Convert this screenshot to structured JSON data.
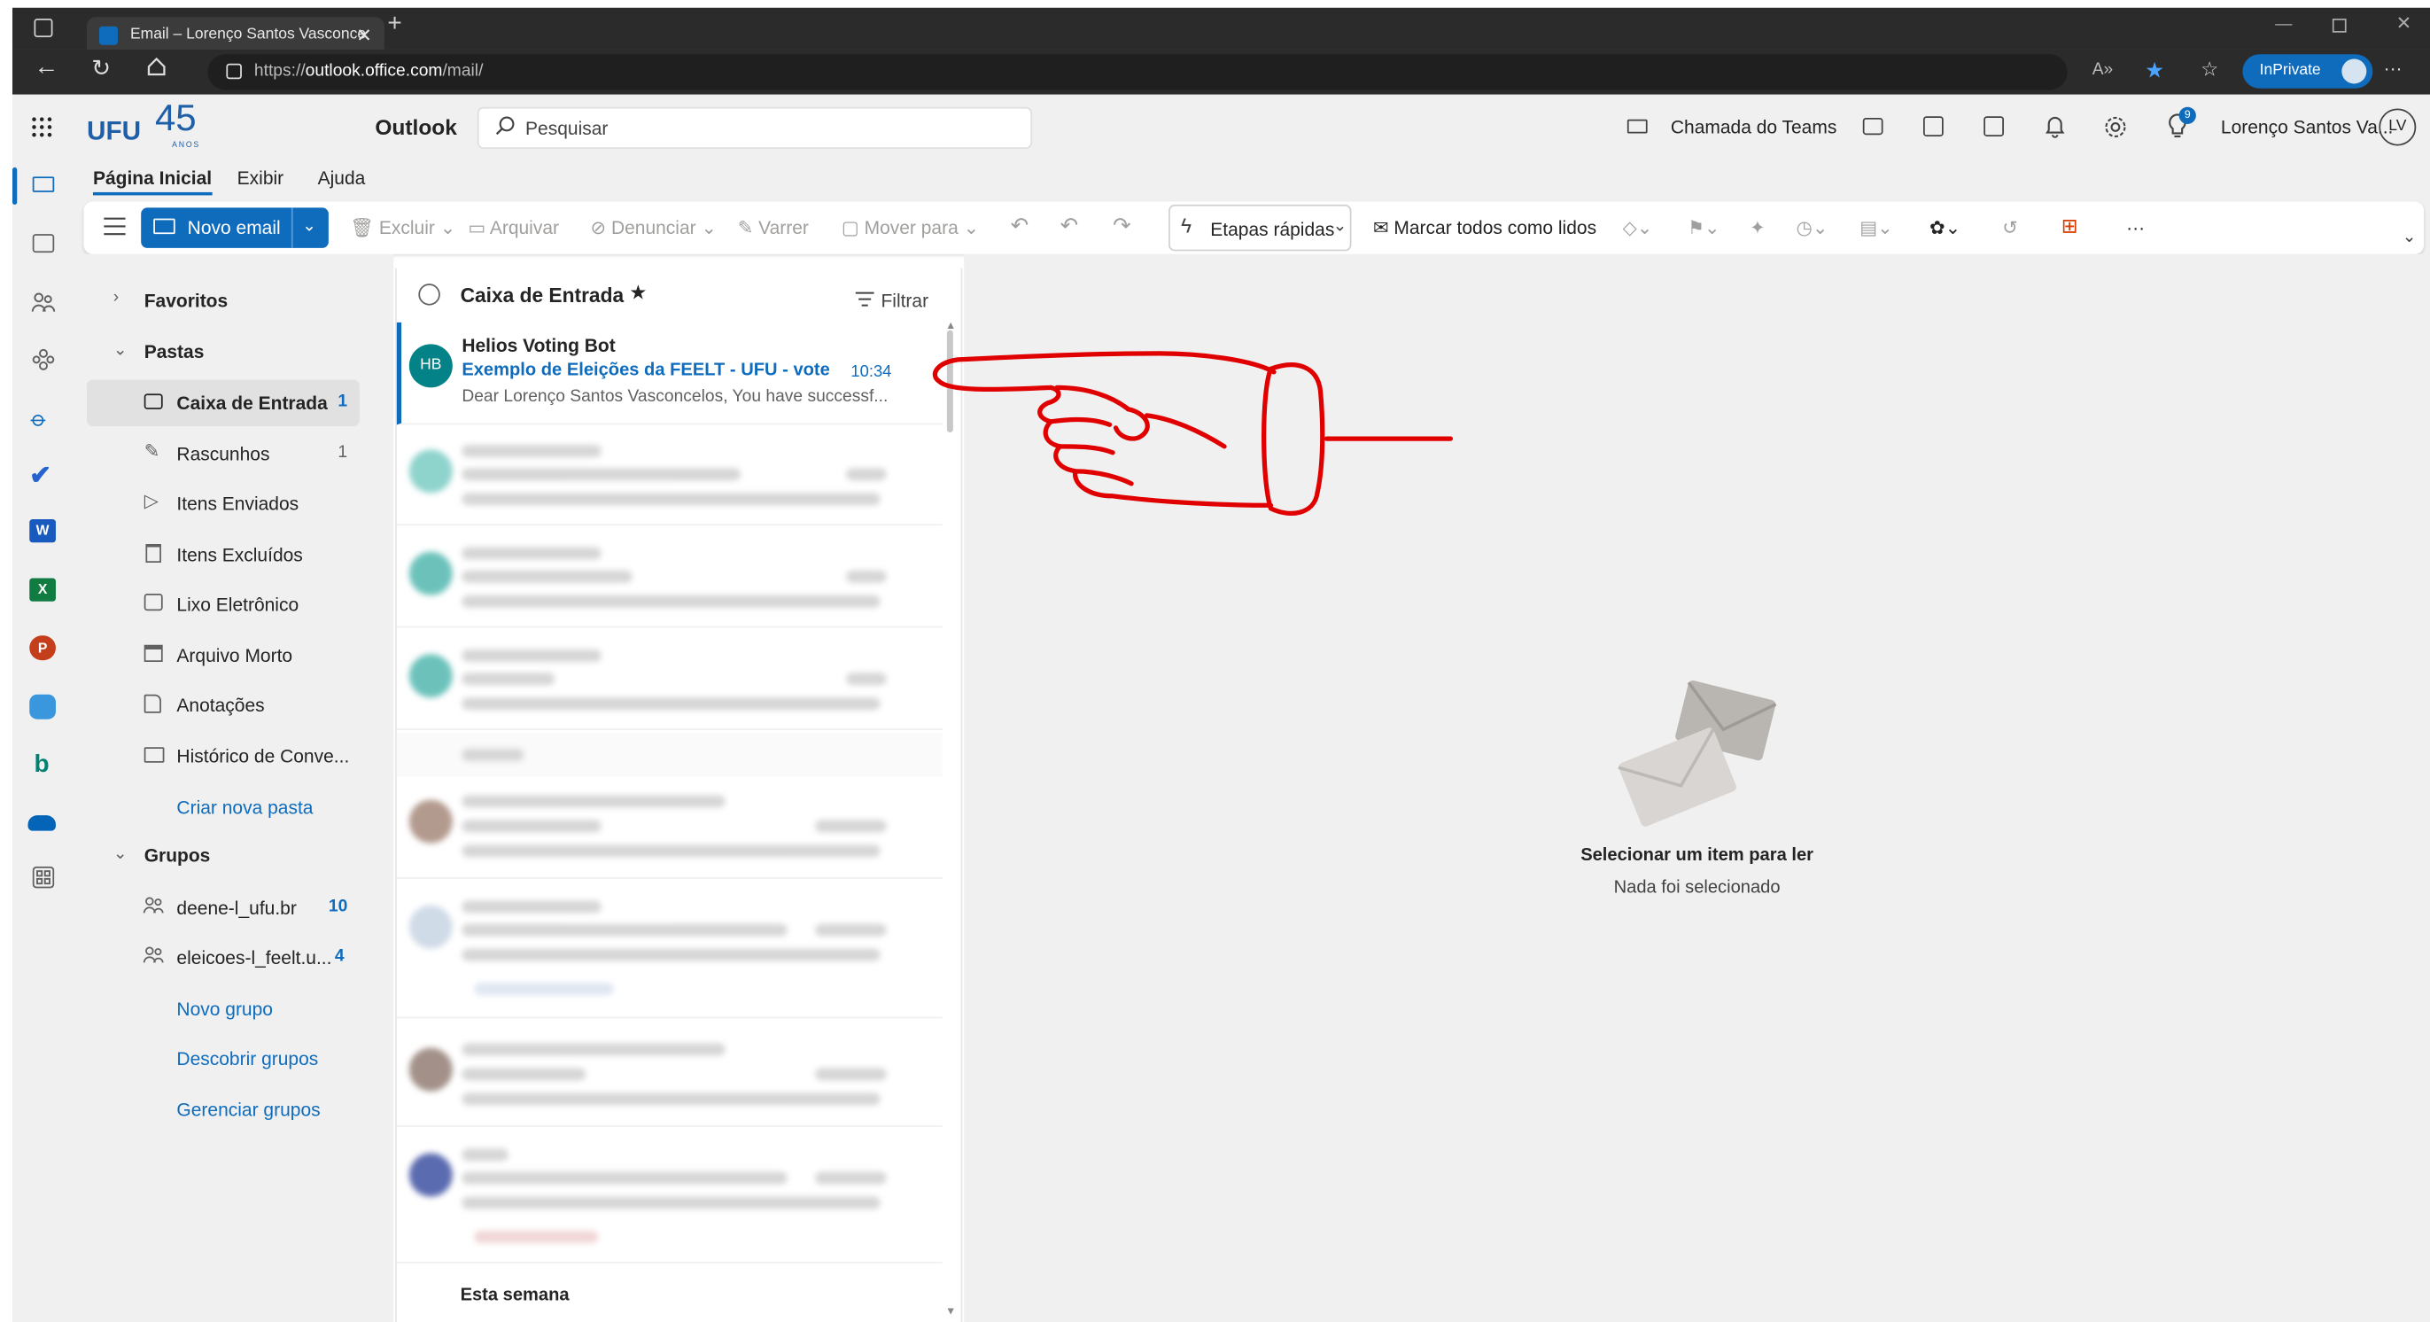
{
  "browser": {
    "tab_title": "Email – Lorenço Santos Vasconce",
    "url_prefix": "https://",
    "url_host": "outlook.office.com",
    "url_path": "/mail/",
    "inprivate_label": "InPrivate"
  },
  "header": {
    "brand": "UFU",
    "brand_years": "45",
    "brand_sub": "ANOS",
    "app_name": "Outlook",
    "search_placeholder": "Pesquisar",
    "teams_call": "Chamada do Teams",
    "tips_badge": "9",
    "user_name": "Lorenço Santos Va...",
    "user_initials": "LV"
  },
  "ribbon": {
    "tabs": [
      {
        "label": "Página Inicial",
        "active": true
      },
      {
        "label": "Exibir",
        "active": false
      },
      {
        "label": "Ajuda",
        "active": false
      }
    ],
    "new_mail": "Novo email",
    "delete": "Excluir",
    "archive": "Arquivar",
    "report": "Denunciar",
    "sweep": "Varrer",
    "move_to": "Mover para",
    "quick_steps": "Etapas rápidas",
    "mark_all_read": "Marcar todos como lidos",
    "more": "···"
  },
  "nav": {
    "favorites": "Favoritos",
    "folders_heading": "Pastas",
    "folders": [
      {
        "label": "Caixa de Entrada",
        "count": "1",
        "icon": "inbox-icon",
        "selected": true
      },
      {
        "label": "Rascunhos",
        "count": "1",
        "icon": "draft-pencil-icon"
      },
      {
        "label": "Itens Enviados",
        "count": "",
        "icon": "send-icon"
      },
      {
        "label": "Itens Excluídos",
        "count": "",
        "icon": "trash-icon"
      },
      {
        "label": "Lixo Eletrônico",
        "count": "",
        "icon": "junk-icon"
      },
      {
        "label": "Arquivo Morto",
        "count": "",
        "icon": "archive-icon"
      },
      {
        "label": "Anotações",
        "count": "",
        "icon": "note-icon"
      },
      {
        "label": "Histórico de Conve...",
        "count": "",
        "icon": "folder-icon"
      }
    ],
    "create_folder": "Criar nova pasta",
    "groups_heading": "Grupos",
    "groups": [
      {
        "label": "deene-l_ufu.br",
        "count": "10"
      },
      {
        "label": "eleicoes-l_feelt.u...",
        "count": "4"
      }
    ],
    "new_group": "Novo grupo",
    "discover_groups": "Descobrir grupos",
    "manage_groups": "Gerenciar grupos"
  },
  "list": {
    "title": "Caixa de Entrada",
    "filter": "Filtrar",
    "first_message": {
      "avatar": "HB",
      "sender": "Helios Voting Bot",
      "subject": "Exemplo de Eleições da FEELT - UFU - vote c...",
      "time": "10:34",
      "preview": "Dear Lorenço Santos Vasconcelos, You have successf..."
    },
    "section_week": "Esta semana"
  },
  "reading": {
    "empty_title": "Selecionar um item para ler",
    "empty_sub": "Nada foi selecionado"
  },
  "colors": {
    "accent": "#0f6cbd",
    "avatar_teal": "#038387",
    "annotation_red": "#e10000"
  }
}
